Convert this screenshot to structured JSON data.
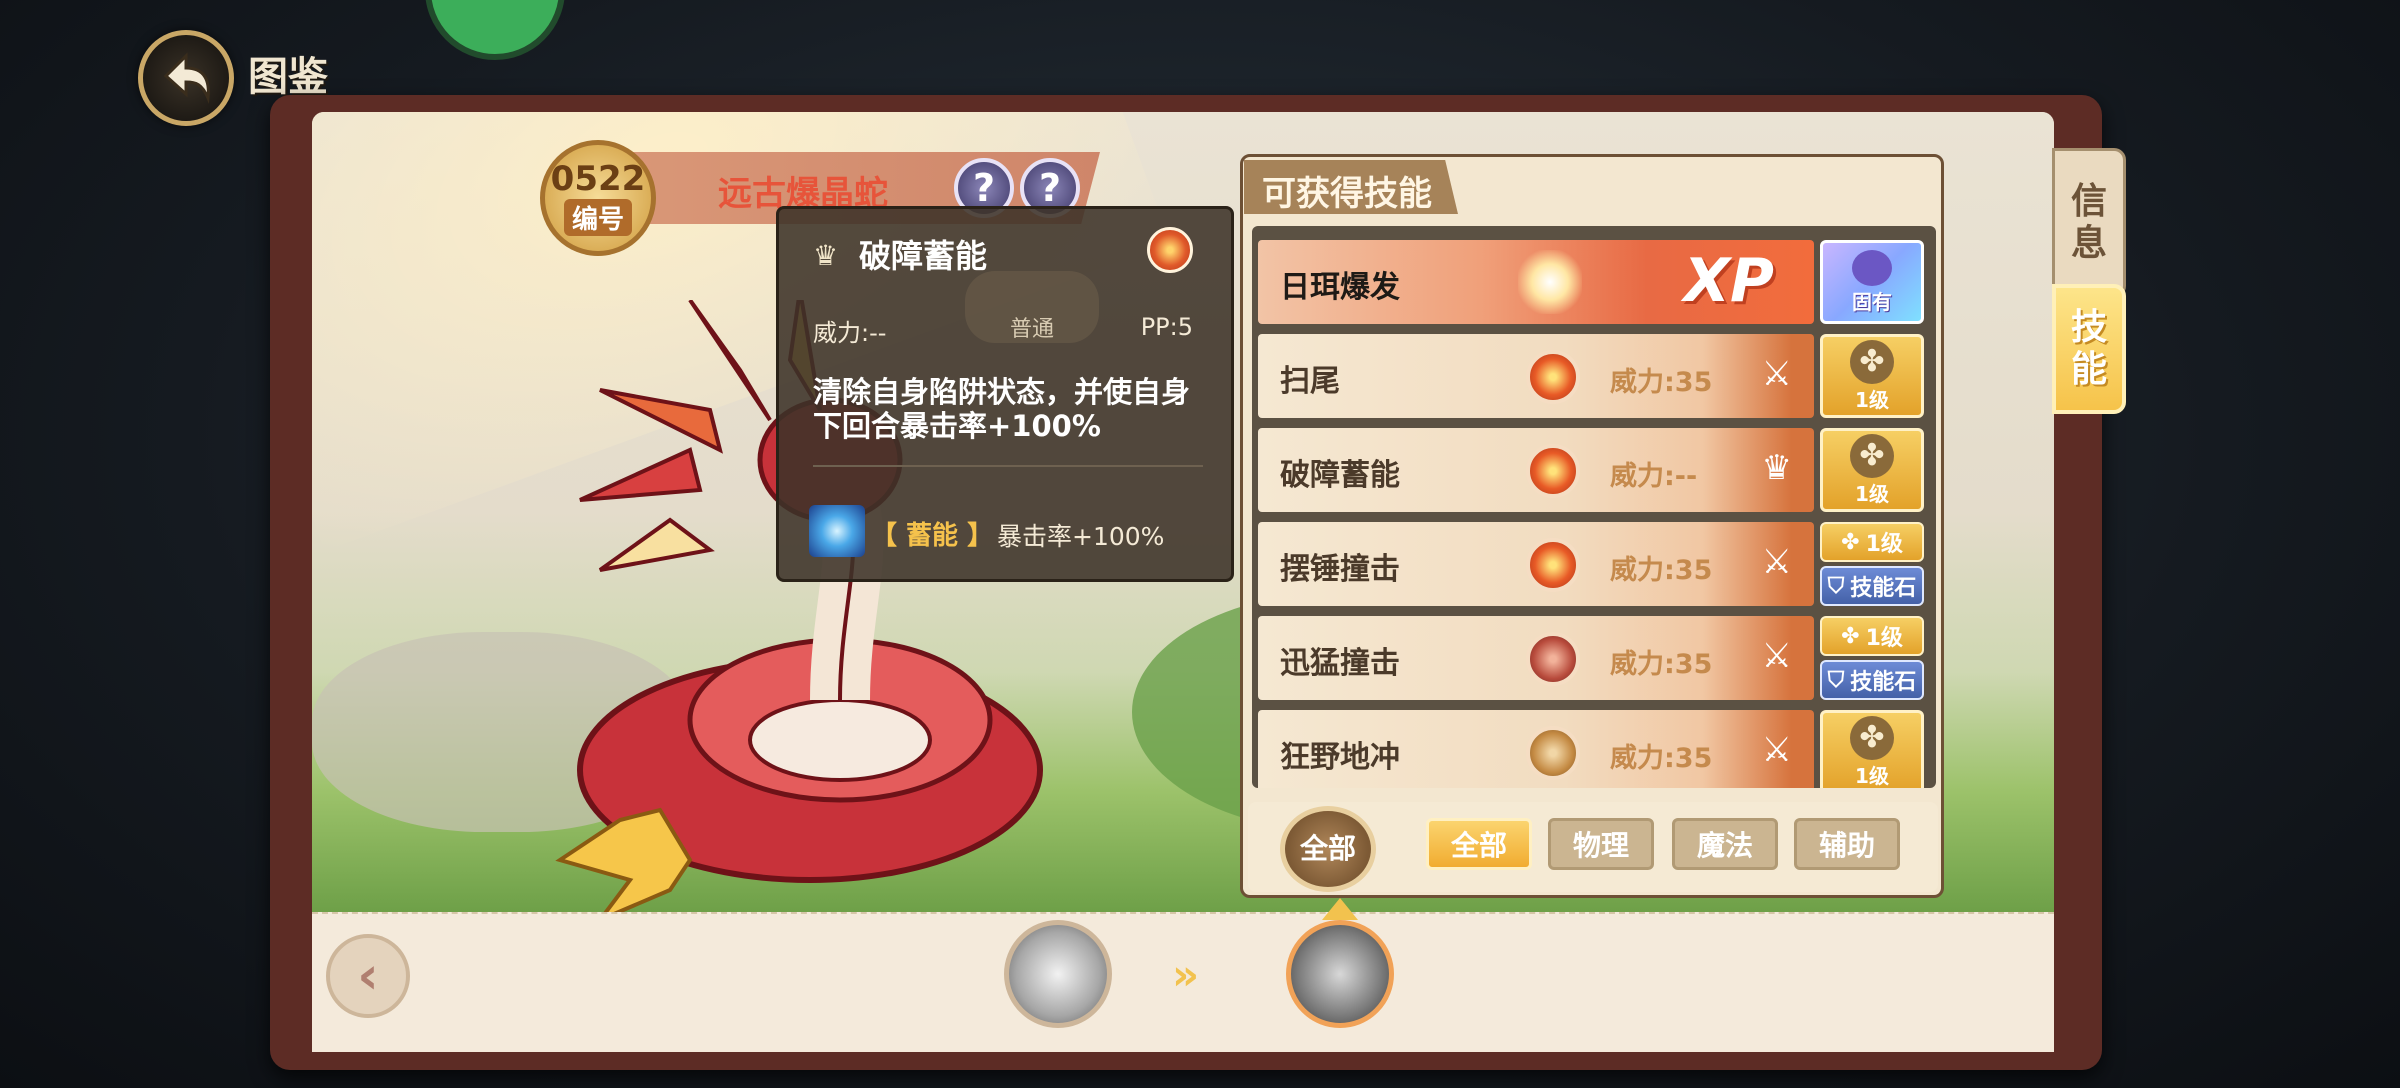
{
  "header": {
    "title": "图鉴"
  },
  "pet": {
    "number": "0522",
    "number_label": "编号",
    "name": "远古爆晶蛇",
    "help_buttons": [
      "?",
      "?"
    ]
  },
  "tooltip": {
    "skill_name": "破障蓄能",
    "category": "普通",
    "power": "威力:--",
    "pp": "PP:5",
    "description": "清除自身陷阱状态，并使自身下回合暴击率+100%",
    "effect_tag": "【 蓄能 】",
    "effect_text": "暴击率+100%"
  },
  "skills_panel": {
    "title": "可获得技能",
    "skills": [
      {
        "name": "日珥爆发",
        "type": "fire",
        "xp": "XP",
        "badge": "innate",
        "badge_text": "固有"
      },
      {
        "name": "扫尾",
        "type": "fire",
        "power": "威力:35",
        "category_icon": "sword-icon",
        "badge": "level",
        "badge_text": "1级"
      },
      {
        "name": "破障蓄能",
        "type": "fire",
        "power": "威力:--",
        "category_icon": "crown-icon",
        "badge": "level",
        "badge_text": "1级"
      },
      {
        "name": "摆锤撞击",
        "type": "fire",
        "power": "威力:35",
        "category_icon": "sword-icon",
        "badge": "split",
        "badge_text": "1级",
        "badge_text2": "技能石"
      },
      {
        "name": "迅猛撞击",
        "type": "dragon",
        "power": "威力:35",
        "category_icon": "sword-icon",
        "badge": "split",
        "badge_text": "1级",
        "badge_text2": "技能石"
      },
      {
        "name": "狂野地冲",
        "type": "ground",
        "power": "威力:35",
        "category_icon": "sword-icon",
        "badge": "level",
        "badge_text": "1级"
      }
    ]
  },
  "filters": {
    "all_circle": "全部",
    "buttons": [
      "全部",
      "物理",
      "魔法",
      "辅助"
    ],
    "active": "全部"
  },
  "side_tabs": {
    "info": "信息",
    "skill": "技能",
    "active": "技能"
  },
  "colors": {
    "accent": "#f1ac30",
    "panel": "#f3e7d0",
    "frame": "#5d2c25"
  }
}
